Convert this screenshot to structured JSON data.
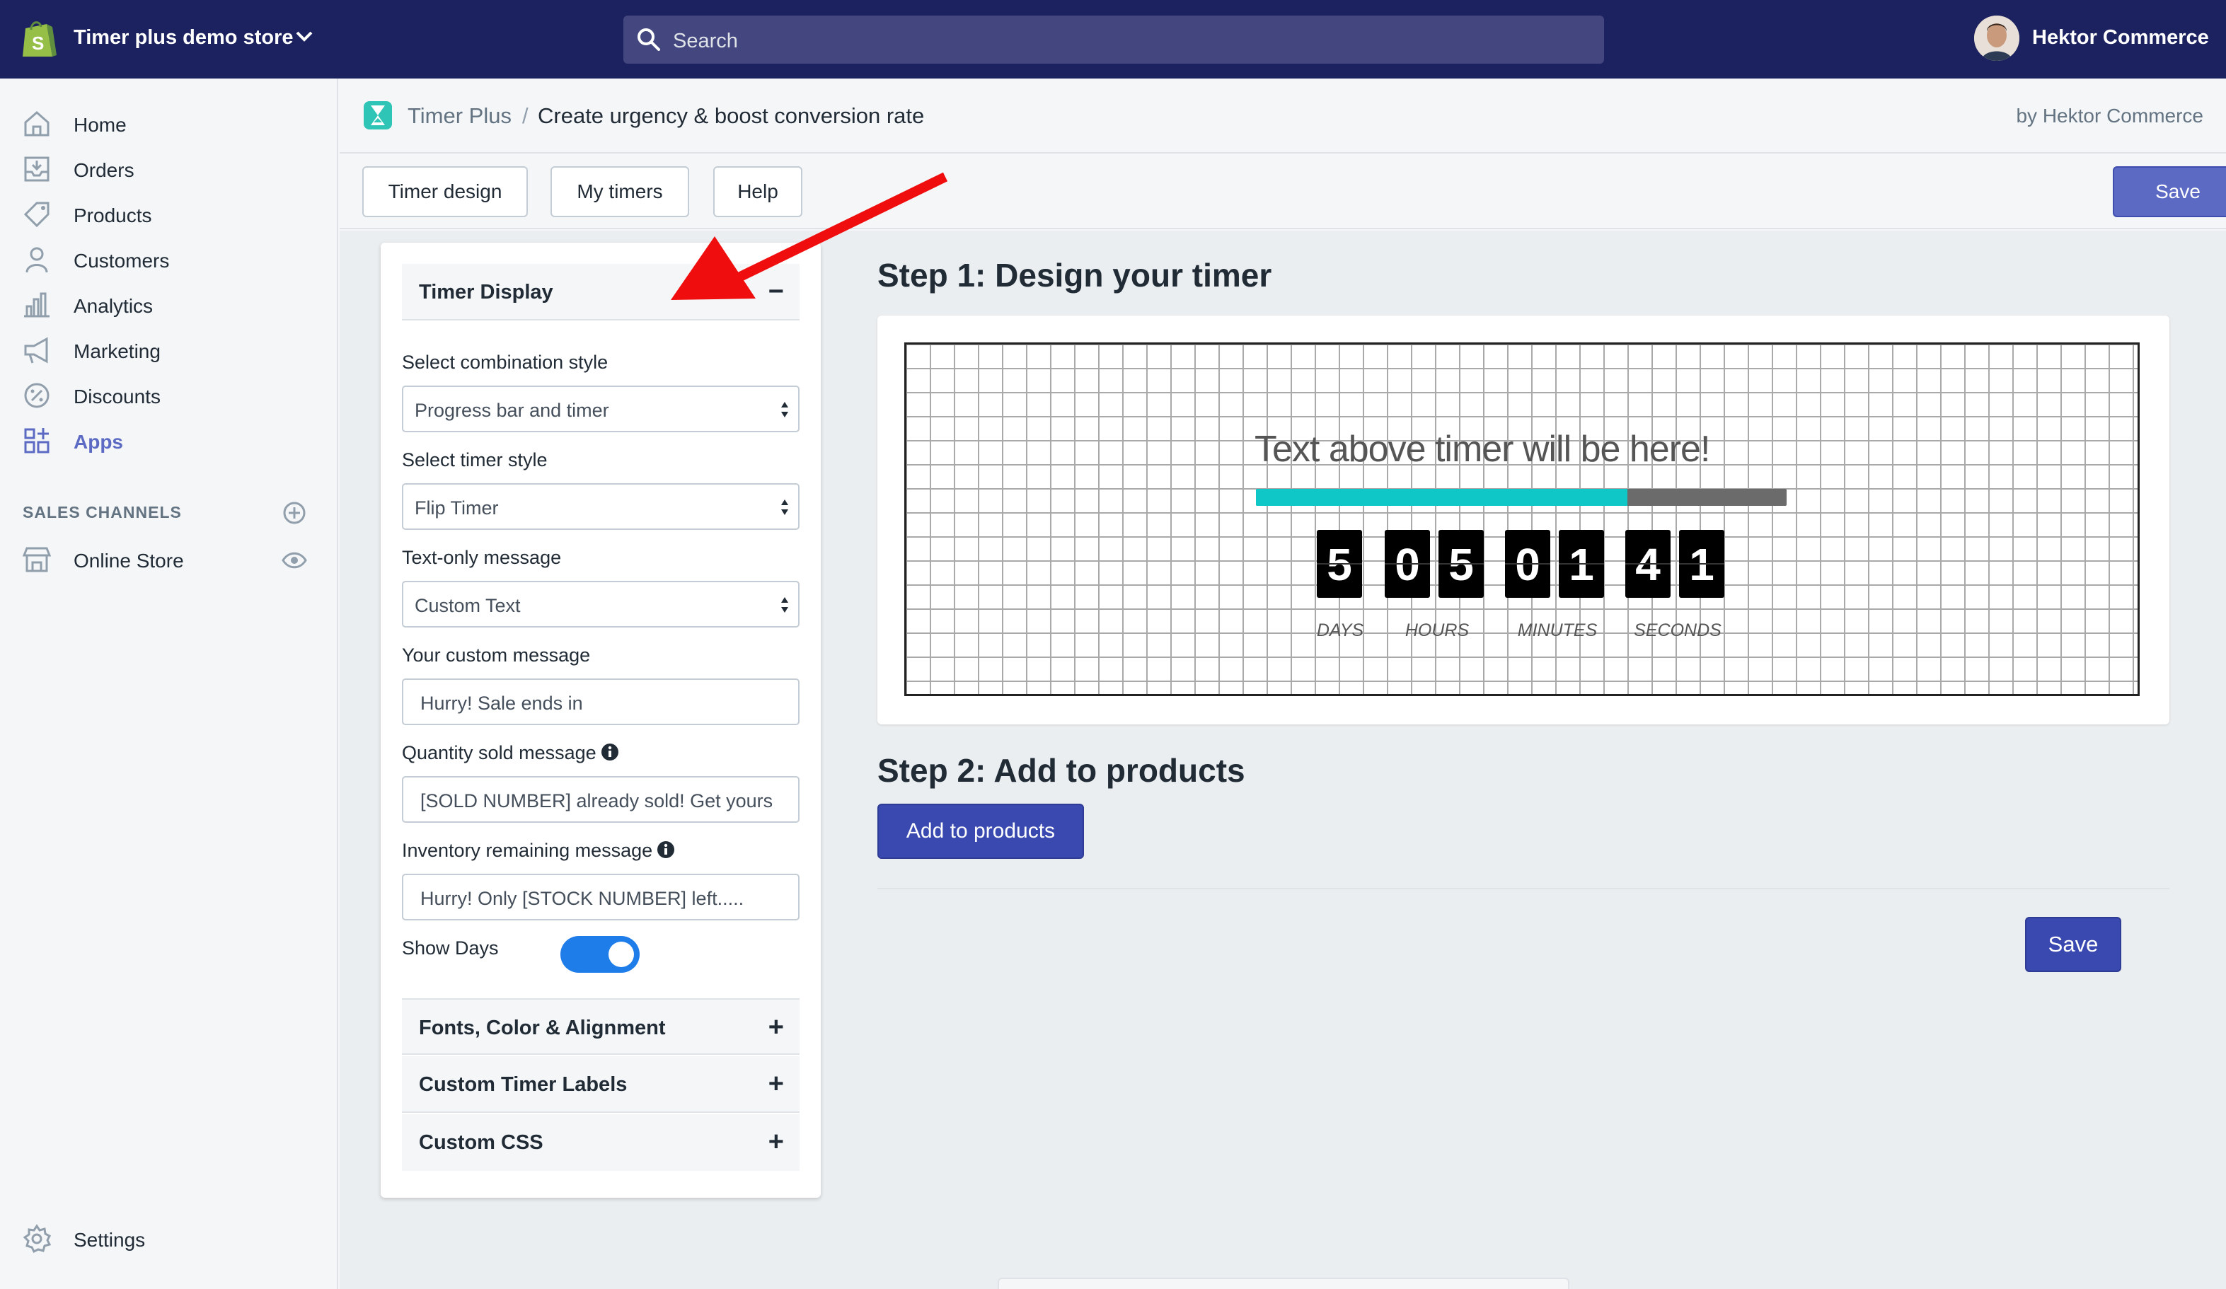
{
  "topbar": {
    "store_name": "Timer plus demo store",
    "search_placeholder": "Search",
    "user_name": "Hektor Commerce"
  },
  "sidebar": {
    "items": [
      {
        "label": "Home",
        "icon": "home-icon"
      },
      {
        "label": "Orders",
        "icon": "orders-icon"
      },
      {
        "label": "Products",
        "icon": "products-tag-icon"
      },
      {
        "label": "Customers",
        "icon": "customers-icon"
      },
      {
        "label": "Analytics",
        "icon": "analytics-icon"
      },
      {
        "label": "Marketing",
        "icon": "marketing-megaphone-icon"
      },
      {
        "label": "Discounts",
        "icon": "discounts-icon"
      },
      {
        "label": "Apps",
        "icon": "apps-icon",
        "active": true
      }
    ],
    "sales_channels_heading": "SALES CHANNELS",
    "online_store": "Online Store",
    "settings": "Settings"
  },
  "app_header": {
    "app_name": "Timer Plus",
    "separator": "/",
    "page_title": "Create urgency & boost conversion rate",
    "by_line": "by Hektor Commerce"
  },
  "toolbar": {
    "tabs": [
      "Timer design",
      "My timers",
      "Help"
    ],
    "save_label": "Save"
  },
  "settings_panel": {
    "timer_display_title": "Timer Display",
    "collapse_symbol": "−",
    "combination_label": "Select combination style",
    "combination_value": "Progress bar and timer",
    "timer_style_label": "Select timer style",
    "timer_style_value": "Flip Timer",
    "text_only_label": "Text-only message",
    "text_only_value": "Custom Text",
    "custom_message_label": "Your custom message",
    "custom_message_value": "Hurry! Sale ends in",
    "qty_sold_label": "Quantity sold message",
    "qty_sold_value": "[SOLD NUMBER] already sold! Get yours",
    "inventory_label": "Inventory remaining message",
    "inventory_value": "Hurry! Only [STOCK NUMBER] left.....",
    "show_days_label": "Show Days",
    "show_days_on": true,
    "sections": [
      {
        "title": "Fonts, Color & Alignment",
        "symbol": "+"
      },
      {
        "title": "Custom Timer Labels",
        "symbol": "+"
      },
      {
        "title": "Custom CSS",
        "symbol": "+"
      }
    ]
  },
  "step1": {
    "title": "Step 1: Design your timer",
    "preview_heading": "Text above timer will be here!",
    "progress_fraction": 0.7,
    "progress_color": "#10c7c7",
    "digits": [
      "5",
      "0",
      "5",
      "0",
      "1",
      "4",
      "1"
    ],
    "unit_labels": [
      "DAYS",
      "HOURS",
      "MINUTES",
      "SECONDS"
    ]
  },
  "step2": {
    "title": "Step 2: Add to products",
    "add_button": "Add to products",
    "save_label": "Save"
  },
  "colors": {
    "topbar": "#1c2260",
    "primary": "#5c6ac4",
    "add_button": "#3a49b0",
    "toggle": "#1e7de8",
    "annotation_arrow": "#f00d0d"
  }
}
